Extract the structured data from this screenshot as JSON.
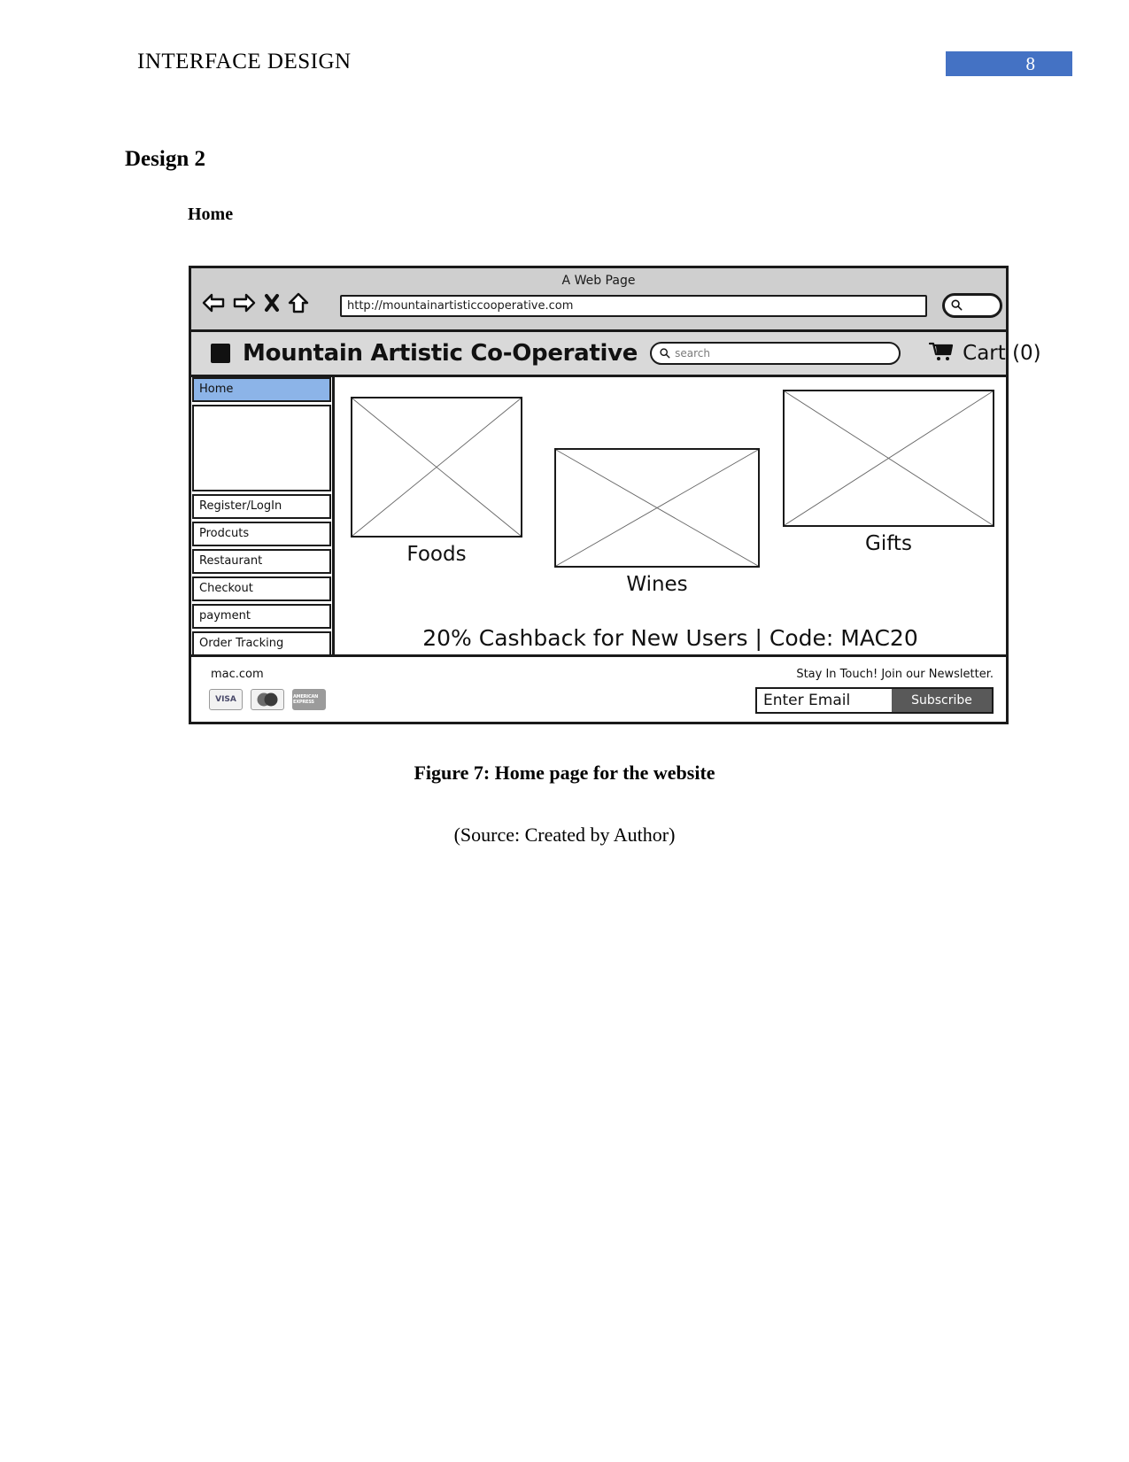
{
  "document": {
    "running_header": "INTERFACE DESIGN",
    "page_number": "8",
    "page_badge_color": "#4472c4",
    "heading_1": "Design 2",
    "heading_2": "Home",
    "figure_caption": "Figure 7: Home page for the website",
    "figure_source": "(Source: Created by Author)"
  },
  "wireframe": {
    "browser": {
      "window_title": "A Web Page",
      "back_icon": "back-arrow-icon",
      "forward_icon": "forward-arrow-icon",
      "stop_icon": "close-x-icon",
      "home_icon": "home-icon",
      "url": "http://mountainartisticcooperative.com",
      "chrome_search_icon": "search-icon"
    },
    "site_header": {
      "logo_icon": "logo-square-icon",
      "brand": "Mountain Artistic Co-Operative",
      "search_icon": "search-icon",
      "search_placeholder": "search",
      "cart_icon": "shopping-cart-icon",
      "cart_label": "Cart (0)"
    },
    "sidebar": {
      "items": [
        {
          "label": "Home",
          "active": true
        },
        {
          "label": "Register/LogIn",
          "active": false
        },
        {
          "label": "Prodcuts",
          "active": false
        },
        {
          "label": "Restaurant",
          "active": false
        },
        {
          "label": "Checkout",
          "active": false
        },
        {
          "label": "payment",
          "active": false
        },
        {
          "label": "Order Tracking",
          "active": false
        }
      ],
      "active_color": "#8cb4e8"
    },
    "tiles": [
      {
        "label": "Foods"
      },
      {
        "label": "Wines"
      },
      {
        "label": "Gifts"
      }
    ],
    "promo_banner": "20% Cashback for New Users | Code: MAC20",
    "footer": {
      "domain": "mac.com",
      "payment_methods": [
        {
          "name": "visa-icon",
          "text": "VISA"
        },
        {
          "name": "mastercard-icon",
          "text": ""
        },
        {
          "name": "amex-icon",
          "text": "AMERICAN EXPRESS"
        }
      ],
      "newsletter_text": "Stay In Touch! Join our Newsletter.",
      "email_value": "Enter Email",
      "subscribe_label": "Subscribe"
    }
  }
}
